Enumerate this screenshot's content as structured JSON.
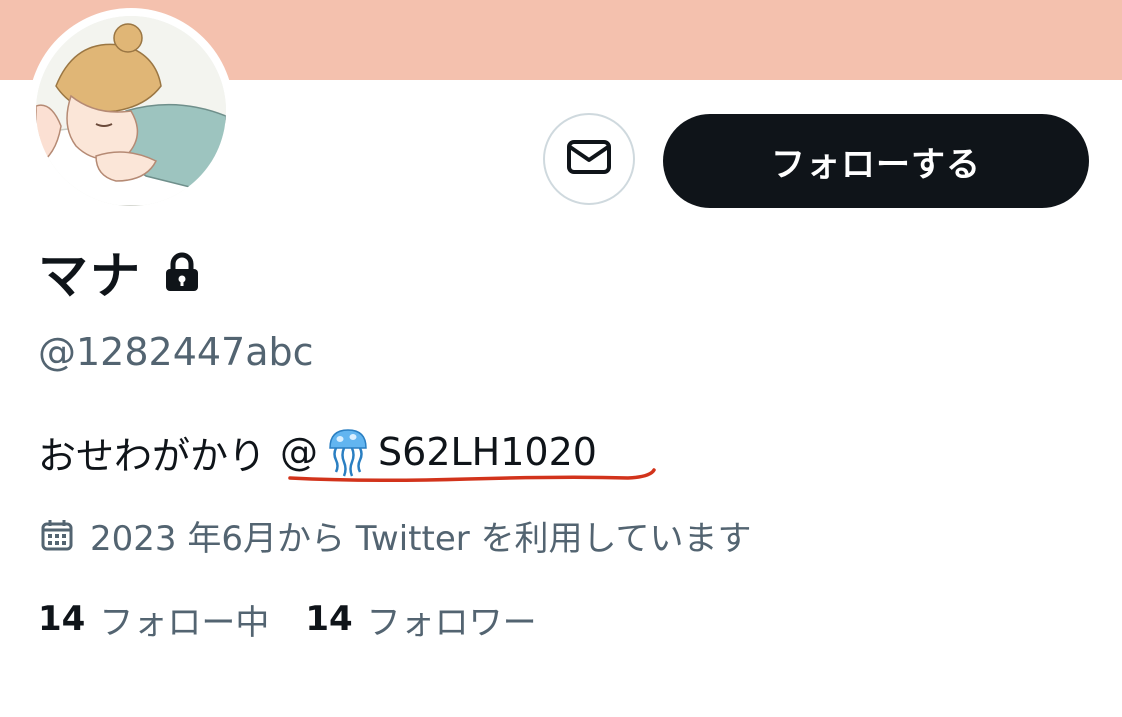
{
  "profile": {
    "display_name": "マナ",
    "handle": "@1282447abc",
    "bio_text": "おせわがかり",
    "bio_mention_at": "@",
    "bio_mention_name": "S62LH1020",
    "joined": "2023 年6月から Twitter を利用しています"
  },
  "actions": {
    "follow_label": "フォローする"
  },
  "stats": {
    "following_count": "14",
    "following_label": "フォロー中",
    "followers_count": "14",
    "followers_label": "フォロワー"
  },
  "colors": {
    "banner": "#f4c1ae",
    "primary_text": "#0f1419",
    "secondary_text": "#536471",
    "underline_annotation": "#d2331b"
  },
  "icons": {
    "message": "mail-icon",
    "protected": "lock-icon",
    "emoji": "jellyfish-icon",
    "joined": "calendar-icon"
  }
}
